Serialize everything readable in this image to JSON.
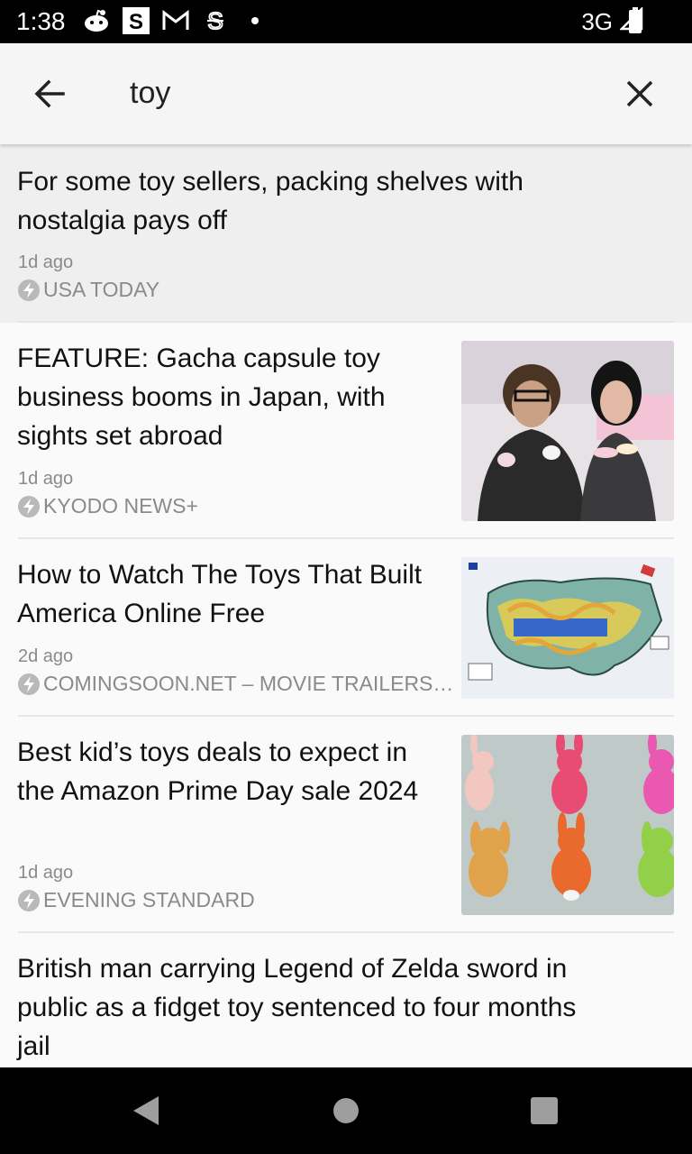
{
  "status_bar": {
    "time": "1:38",
    "network": "3G"
  },
  "search": {
    "query": "toy"
  },
  "articles": [
    {
      "title": "For some toy sellers, packing shelves with nostalgia pays off",
      "time": "1d ago",
      "source": "USA TODAY"
    },
    {
      "title": "FEATURE: Gacha capsule toy business booms in Japan, with sights set abroad",
      "time": "1d ago",
      "source": "KYODO NEWS+"
    },
    {
      "title": "How to Watch The Toys That Built America Online Free",
      "time": "2d ago",
      "source": "COMINGSOON.NET – MOVIE TRAILERS…"
    },
    {
      "title": "Best kid’s toys deals to expect in the Amazon Prime Day sale 2024",
      "time": "1d ago",
      "source": "EVENING STANDARD"
    },
    {
      "title": "British man carrying Legend of Zelda sword in public as a fidget toy sentenced to four months jail"
    }
  ],
  "colors": {
    "accent_gray": "#8a8a8a",
    "background": "#fafafa",
    "highlight": "#efefef"
  },
  "icons": [
    "back-arrow-icon",
    "close-icon",
    "bolt-icon",
    "reddit-icon",
    "s-icon",
    "gmail-icon",
    "s-outline-icon",
    "signal-icon",
    "battery-icon"
  ]
}
